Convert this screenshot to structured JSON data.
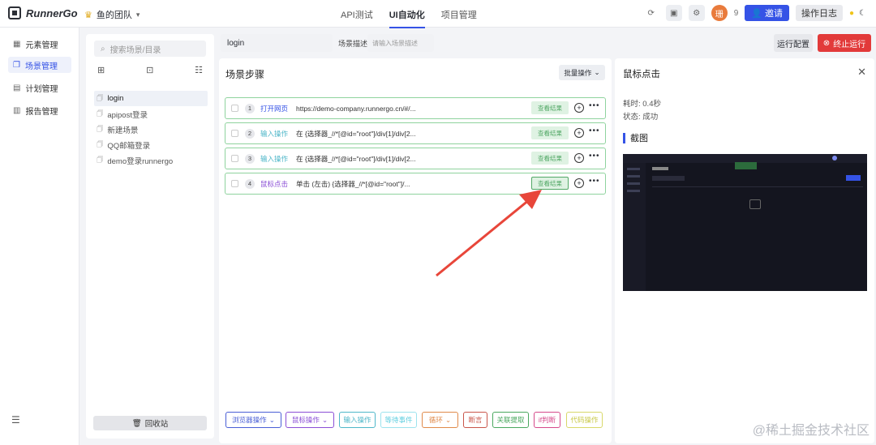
{
  "app": {
    "name": "RunnerGo",
    "team": "鱼的团队"
  },
  "nav": {
    "tabs": [
      "API测试",
      "UI自动化",
      "项目管理"
    ],
    "active_tab": "UI自动化"
  },
  "top_right": {
    "avatar_char": "珊",
    "count": "9",
    "invite_label": "邀请",
    "log_label": "操作日志"
  },
  "sidebar": {
    "items": [
      {
        "label": "元素管理"
      },
      {
        "label": "场景管理"
      },
      {
        "label": "计划管理"
      },
      {
        "label": "报告管理"
      }
    ]
  },
  "scene_panel": {
    "search_placeholder": "搜索场景/目录",
    "items": [
      "login",
      "apipost登录",
      "新建场景",
      "QQ邮箱登录",
      "demo登录runnergo"
    ],
    "selected": "login",
    "recycle_label": "回收站"
  },
  "scene_header": {
    "name": "login",
    "desc_label": "场景描述:",
    "desc_placeholder": "请输入场景描述",
    "run_config_label": "运行配置",
    "stop_label": "终止运行"
  },
  "steps": {
    "title": "场景步骤",
    "batch_label": "批量操作",
    "rows": [
      {
        "num": "1",
        "type": "打开网页",
        "content": "https://demo-company.runnergo.cn/#/...",
        "result": "查看结果"
      },
      {
        "num": "2",
        "type": "输入操作",
        "content": "在 {选择器_//*[@id=\"root\"]/div[1]/div[2...",
        "result": "查看结果"
      },
      {
        "num": "3",
        "type": "输入操作",
        "content": "在 {选择器_//*[@id=\"root\"]/div[1]/div[2...",
        "result": "查看结果"
      },
      {
        "num": "4",
        "type": "鼠标点击",
        "content": "单击 (左击) {选择器_//*[@id=\"root\"]/...",
        "result": "查看结果"
      }
    ],
    "toolbar": [
      {
        "label": "浏览器操作",
        "color": "#4a5fd6",
        "dropdown": true
      },
      {
        "label": "鼠标操作",
        "color": "#8b4fd6",
        "dropdown": true
      },
      {
        "label": "输入操作",
        "color": "#4fb7c9",
        "dropdown": false
      },
      {
        "label": "等待事件",
        "color": "#63cfe0",
        "dropdown": false
      },
      {
        "label": "循环",
        "color": "#e08a4a",
        "dropdown": true
      },
      {
        "label": "断言",
        "color": "#c9554a",
        "dropdown": false
      },
      {
        "label": "关联提取",
        "color": "#4aa85f",
        "dropdown": false
      },
      {
        "label": "if判断",
        "color": "#d64a8b",
        "dropdown": false
      },
      {
        "label": "代码操作",
        "color": "#c9c94a",
        "dropdown": false
      }
    ]
  },
  "detail": {
    "title": "鼠标点击",
    "duration": "耗时: 0.4秒",
    "status": "状态: 成功",
    "screenshot_label": "截图"
  },
  "watermark": "@稀土掘金技术社区",
  "colors": {
    "accent": "#3553e6",
    "danger": "#e23a3a",
    "success": "#52a866",
    "arrow": "#e8463a"
  }
}
